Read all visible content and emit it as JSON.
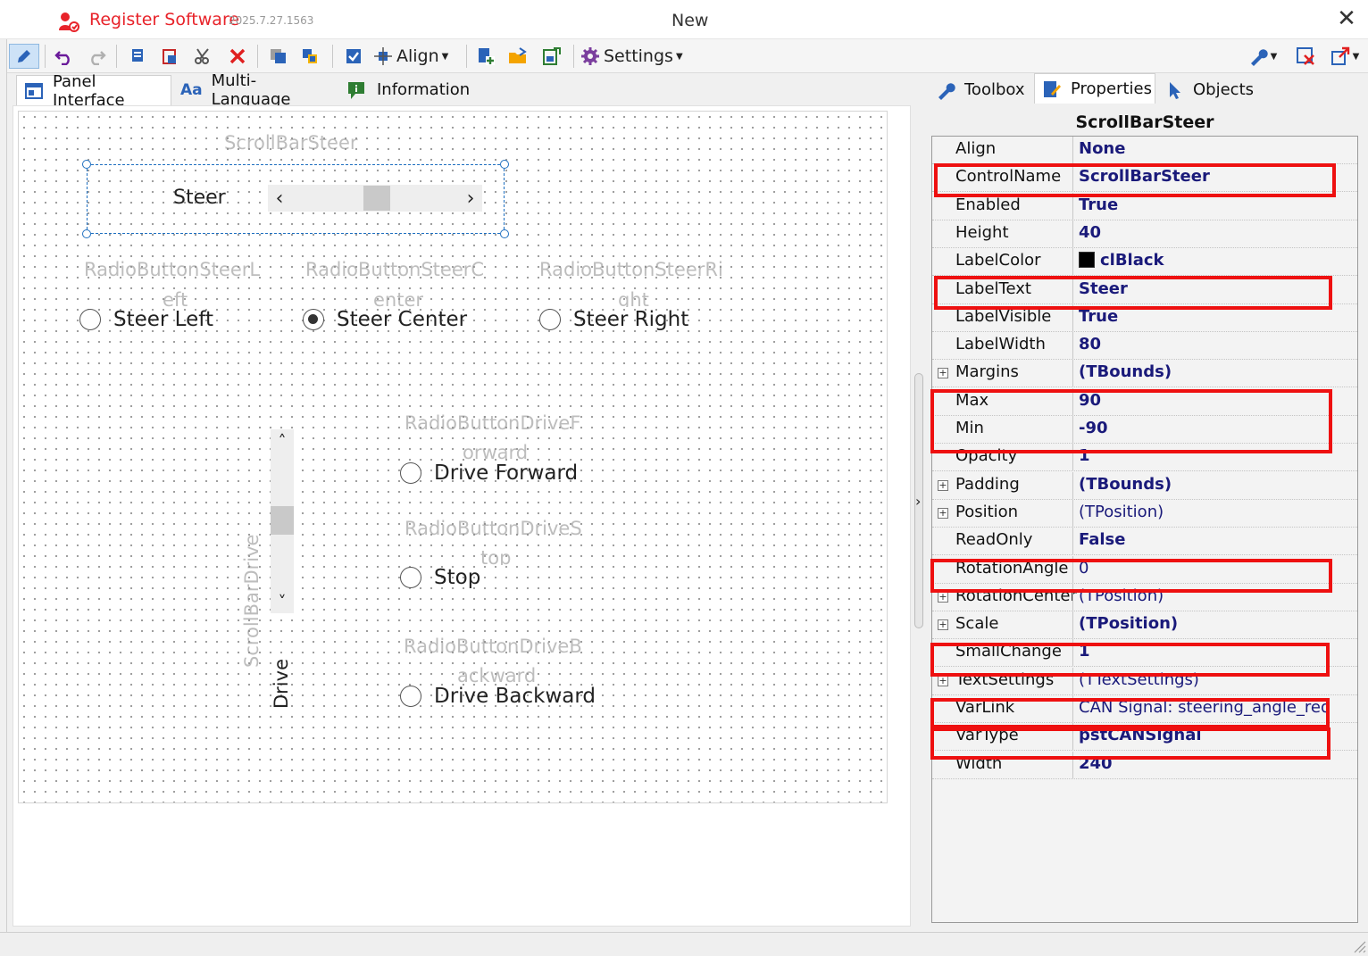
{
  "titlebar": {
    "app_title": "Register Software",
    "version": "2025.7.27.1563",
    "doc_title": "New",
    "close": "✕"
  },
  "toolbar": {
    "align_label": "Align",
    "settings_label": "Settings"
  },
  "left_tabs": [
    {
      "label": "Panel Interface",
      "icon": "panel-icon"
    },
    {
      "label": "Multi-Language",
      "icon": "aa-text-icon"
    },
    {
      "label": "Information",
      "icon": "info-flag-icon"
    }
  ],
  "right_tabs": [
    {
      "label": "Toolbox",
      "icon": "wrench-icon"
    },
    {
      "label": "Properties",
      "icon": "properties-icon"
    },
    {
      "label": "Objects",
      "icon": "cursor-icon"
    }
  ],
  "canvas": {
    "scrollbar_steer_name": "ScrollBarSteer",
    "steer_label": "Steer",
    "hscroll_left": "‹",
    "hscroll_right": "›",
    "radio_steer_left_name_1": "RadioButtonSteerL",
    "radio_steer_left_name_2": "eft",
    "radio_steer_left": "Steer Left",
    "radio_steer_center_name_1": "RadioButtonSteerC",
    "radio_steer_center_name_2": "enter",
    "radio_steer_center": "Steer Center",
    "radio_steer_right_name_1": "RadioButtonSteerRi",
    "radio_steer_right_name_2": "ght",
    "radio_steer_right": "Steer Right",
    "radio_drive_forward_name_1": "RadioButtonDriveF",
    "radio_drive_forward_name_2": "orward",
    "radio_drive_forward": "Drive Forward",
    "radio_drive_stop_name_1": "RadioButtonDriveS",
    "radio_drive_stop_name_2": "top",
    "radio_drive_stop": "Stop",
    "radio_drive_backward_name_1": "RadioButtonDriveB",
    "radio_drive_backward_name_2": "ackward",
    "radio_drive_backward": "Drive Backward",
    "scrollbar_drive_name": "ScrollBarDrive",
    "drive_label": "Drive",
    "vscroll_up": "˄",
    "vscroll_down": "˅"
  },
  "properties": {
    "header": "ScrollBarSteer",
    "rows": [
      {
        "name": "Align",
        "value": "None",
        "bold": true,
        "expandable": false
      },
      {
        "name": "ControlName",
        "value": "ScrollBarSteer",
        "bold": true,
        "expandable": false
      },
      {
        "name": "Enabled",
        "value": "True",
        "bold": true,
        "expandable": false
      },
      {
        "name": "Height",
        "value": "40",
        "bold": true,
        "expandable": false
      },
      {
        "name": "LabelColor",
        "value": "clBlack",
        "bold": true,
        "expandable": false
      },
      {
        "name": "LabelText",
        "value": "Steer",
        "bold": true,
        "expandable": false
      },
      {
        "name": "LabelVisible",
        "value": "True",
        "bold": true,
        "expandable": false
      },
      {
        "name": "LabelWidth",
        "value": "80",
        "bold": true,
        "expandable": false
      },
      {
        "name": "Margins",
        "value": "(TBounds)",
        "bold": true,
        "expandable": true
      },
      {
        "name": "Max",
        "value": "90",
        "bold": true,
        "expandable": false
      },
      {
        "name": "Min",
        "value": "-90",
        "bold": true,
        "expandable": false
      },
      {
        "name": "Opacity",
        "value": "1",
        "bold": true,
        "expandable": false
      },
      {
        "name": "Padding",
        "value": "(TBounds)",
        "bold": true,
        "expandable": true
      },
      {
        "name": "Position",
        "value": "(TPosition)",
        "bold": false,
        "expandable": true
      },
      {
        "name": "ReadOnly",
        "value": "False",
        "bold": true,
        "expandable": false
      },
      {
        "name": "RotationAngle",
        "value": "0",
        "bold": false,
        "expandable": false
      },
      {
        "name": "RotationCenter",
        "value": "(TPosition)",
        "bold": false,
        "expandable": true
      },
      {
        "name": "Scale",
        "value": "(TPosition)",
        "bold": true,
        "expandable": true
      },
      {
        "name": "SmallChange",
        "value": "1",
        "bold": true,
        "expandable": false
      },
      {
        "name": "TextSettings",
        "value": "(TTextSettings)",
        "bold": false,
        "expandable": true
      },
      {
        "name": "VarLink",
        "value": "CAN Signal: steering_angle_req",
        "bold": false,
        "expandable": false
      },
      {
        "name": "VarType",
        "value": "pstCANSignal",
        "bold": true,
        "expandable": false
      },
      {
        "name": "Width",
        "value": "240",
        "bold": true,
        "expandable": false
      }
    ],
    "label_color_swatch": "#000000"
  },
  "colors": {
    "brand_red": "#e8232a",
    "highlight_red": "#ee1010",
    "selection_blue": "#1e6fc0",
    "value_navy": "#1a1a7a"
  }
}
